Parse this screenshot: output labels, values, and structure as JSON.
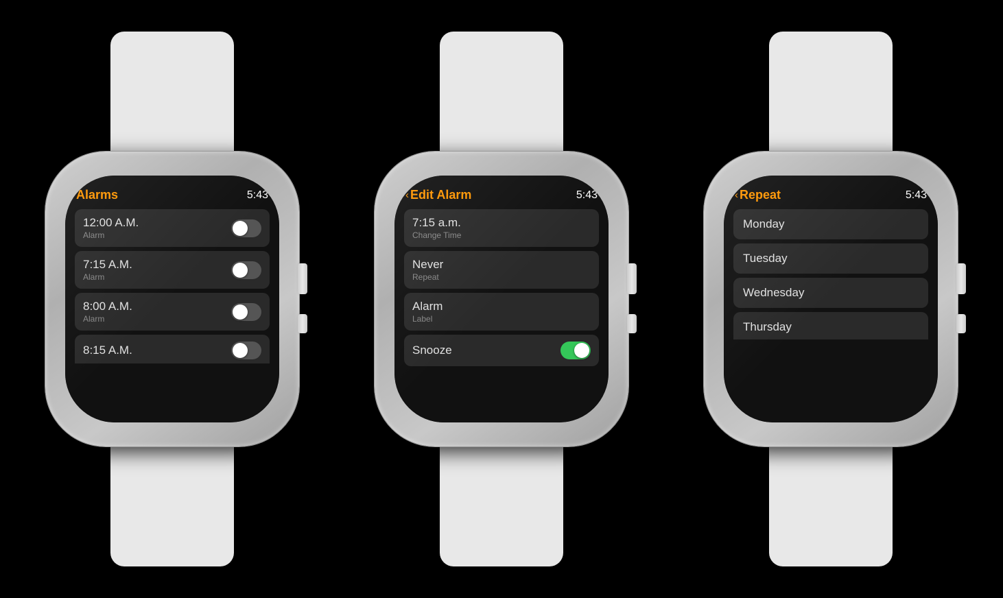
{
  "watches": [
    {
      "id": "alarms",
      "header": {
        "title": "Alarms",
        "time": "5:43",
        "hasBack": false
      },
      "items": [
        {
          "main": "12:00 A.M.",
          "sub": "Alarm",
          "toggle": "off"
        },
        {
          "main": "7:15 A.M.",
          "sub": "Alarm",
          "toggle": "off"
        },
        {
          "main": "8:00 A.M.",
          "sub": "Alarm",
          "toggle": "off"
        },
        {
          "main": "8:15 A.M.",
          "sub": null,
          "toggle": "off",
          "partial": true
        }
      ]
    },
    {
      "id": "edit-alarm",
      "header": {
        "title": "Edit Alarm",
        "time": "5:43",
        "hasBack": true,
        "backLabel": "‹"
      },
      "items": [
        {
          "main": "7:15 a.m.",
          "sub": "Change Time",
          "toggle": null
        },
        {
          "main": "Never",
          "sub": "Repeat",
          "toggle": null
        },
        {
          "main": "Alarm",
          "sub": "Label",
          "toggle": null
        },
        {
          "main": "Snooze",
          "sub": null,
          "toggle": "on"
        }
      ]
    },
    {
      "id": "repeat",
      "header": {
        "title": "Repeat",
        "time": "5:43",
        "hasBack": true,
        "backLabel": "‹"
      },
      "days": [
        "Monday",
        "Tuesday",
        "Wednesday",
        "Thursday"
      ]
    }
  ]
}
